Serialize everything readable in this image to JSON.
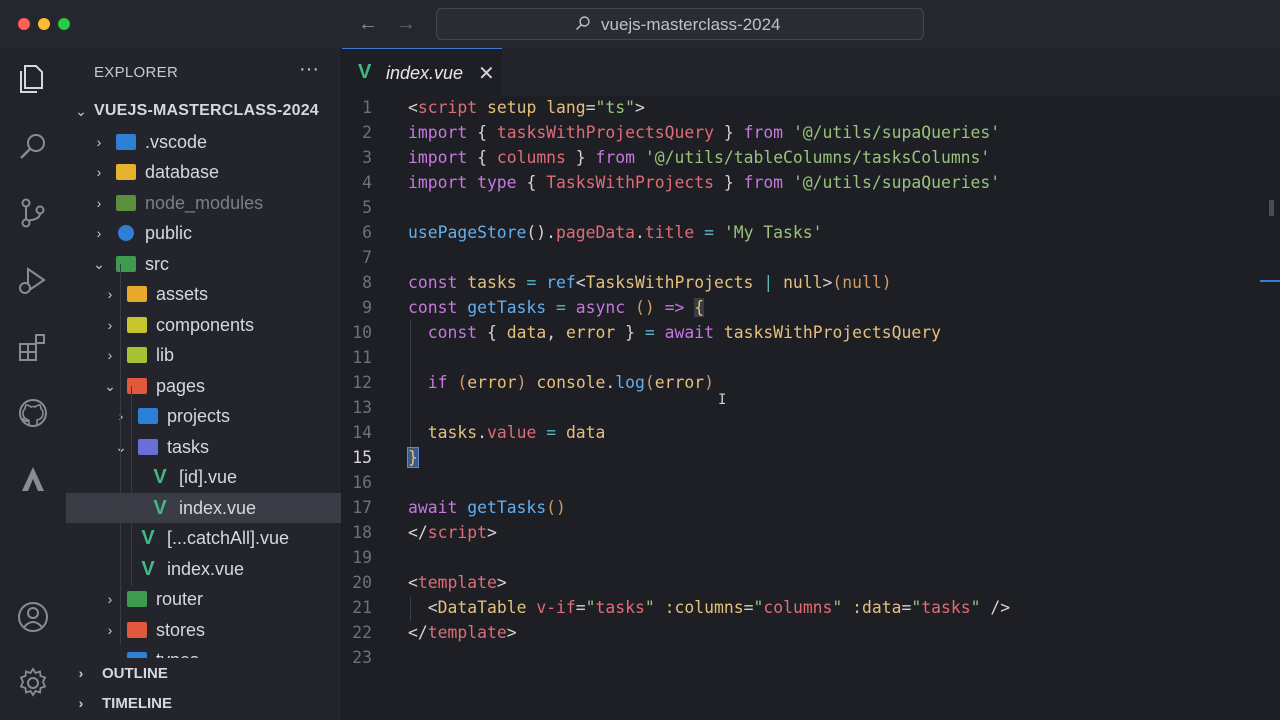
{
  "titlebar": {
    "search_text": "vuejs-masterclass-2024",
    "traffic_colors": [
      "#ff5f57",
      "#febc2e",
      "#28c840"
    ]
  },
  "activity": {
    "icons": [
      "files-icon",
      "search-icon",
      "source-control-icon",
      "run-debug-icon",
      "extensions-icon",
      "github-icon",
      "triangle-icon",
      "account-icon",
      "settings-gear-icon"
    ]
  },
  "sidebar": {
    "title": "EXPLORER",
    "more": "···",
    "project": "VUEJS-MASTERCLASS-2024",
    "items": [
      {
        "label": ".vscode"
      },
      {
        "label": "database"
      },
      {
        "label": "node_modules"
      },
      {
        "label": "public"
      },
      {
        "label": "src"
      },
      {
        "label": "assets"
      },
      {
        "label": "components"
      },
      {
        "label": "lib"
      },
      {
        "label": "pages"
      },
      {
        "label": "projects"
      },
      {
        "label": "tasks"
      },
      {
        "label": "[id].vue"
      },
      {
        "label": "index.vue"
      },
      {
        "label": "[...catchAll].vue"
      },
      {
        "label": "index.vue"
      },
      {
        "label": "router"
      },
      {
        "label": "stores"
      },
      {
        "label": "types"
      }
    ],
    "sections": [
      "OUTLINE",
      "TIMELINE"
    ]
  },
  "editor": {
    "tab_label": "index.vue",
    "tab_close": "✕",
    "line_numbers": [
      "1",
      "2",
      "3",
      "4",
      "5",
      "6",
      "7",
      "8",
      "9",
      "10",
      "11",
      "12",
      "13",
      "14",
      "15",
      "16",
      "17",
      "18",
      "19",
      "20",
      "21",
      "22",
      "23"
    ],
    "current_line": "15",
    "accent": "#3a7bd5"
  }
}
